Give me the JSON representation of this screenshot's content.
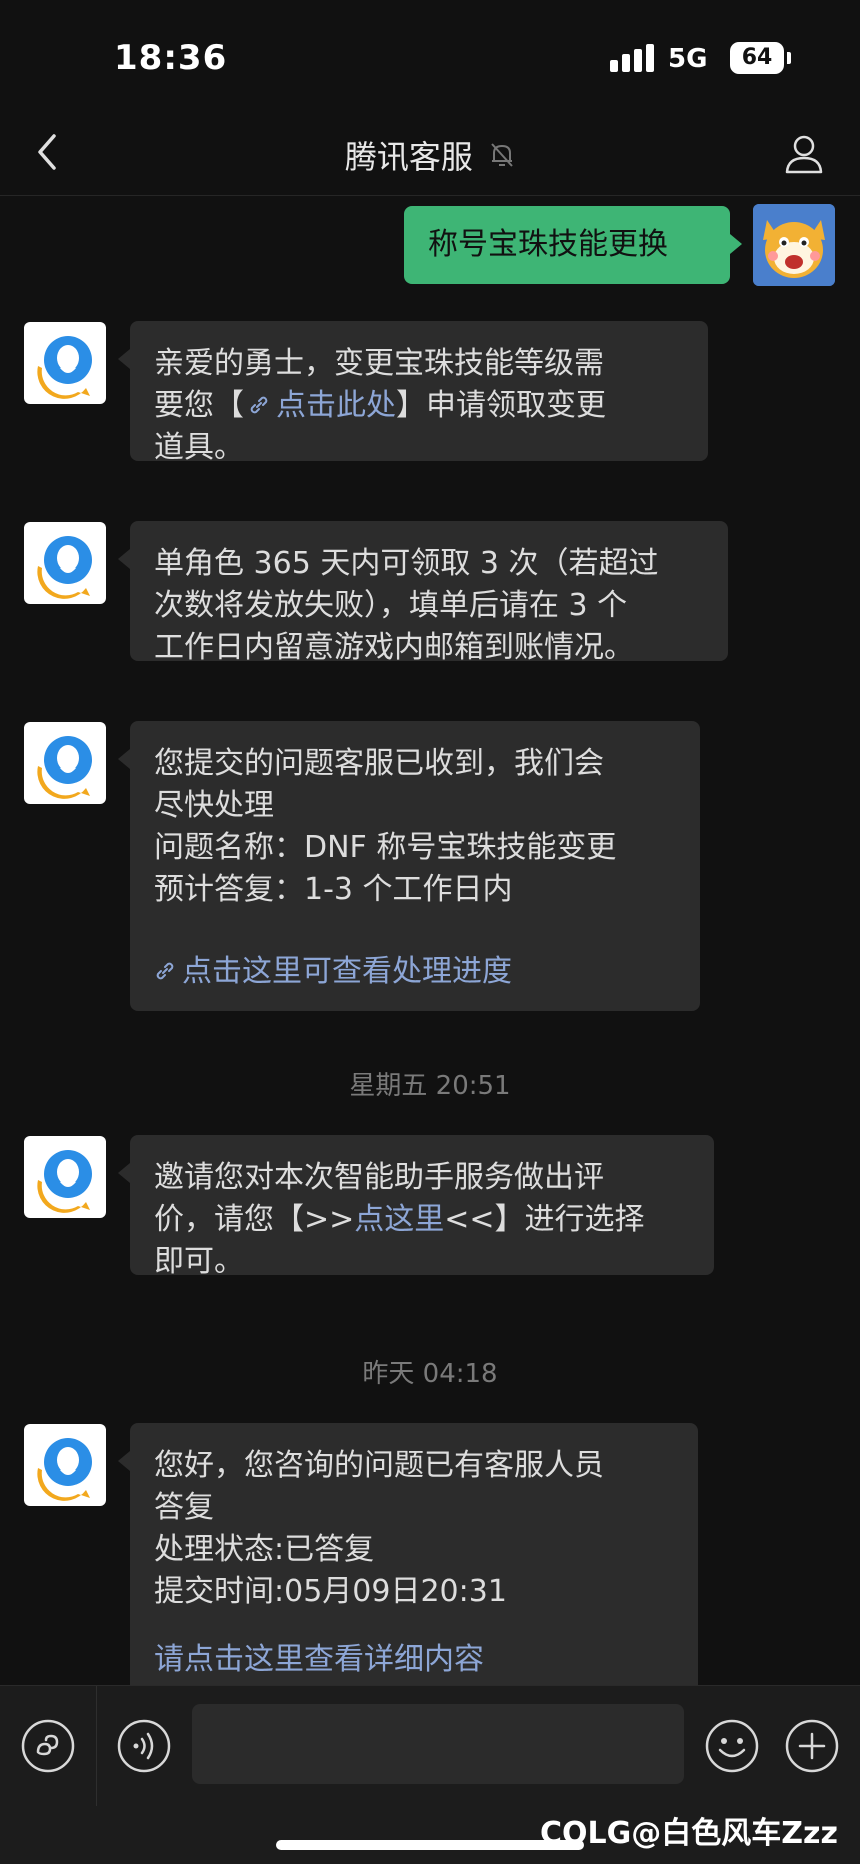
{
  "status_bar": {
    "time": "18:36",
    "network": "5G",
    "battery": "64"
  },
  "nav": {
    "title": "腾讯客服"
  },
  "messages": {
    "user_request": "称号宝珠技能更换",
    "m1": {
      "line1": "亲爱的勇士，变更宝珠技能等级需",
      "line2_pre": "要您【",
      "line2_link": "点击此处",
      "line2_post": "】申请领取变更",
      "line3": "道具。"
    },
    "m2": {
      "line1": "单角色 365 天内可领取 3 次（若超过",
      "line2": "次数将发放失败），填单后请在 3 个",
      "line3": "工作日内留意游戏内邮箱到账情况。"
    },
    "m3": {
      "line1": "您提交的问题客服已收到，我们会",
      "line2": "尽快处理",
      "line3": "问题名称：DNF 称号宝珠技能变更",
      "line4": "预计答复：1-3 个工作日内",
      "link": "点击这里可查看处理进度"
    },
    "ts1": "星期五 20:51",
    "m4": {
      "line1": "邀请您对本次智能助手服务做出评",
      "line2_pre": "价，请您【>>",
      "line2_link": "点这里",
      "line2_post": "<<】进行选择",
      "line3": "即可。"
    },
    "ts2": "昨天 04:18",
    "m5": {
      "line1": "您好，您咨询的问题已有客服人员",
      "line2": "答复",
      "line3": "处理状态:已答复",
      "line4": "提交时间:05月09日20:31",
      "link": "请点击这里查看详细内容"
    }
  },
  "watermark": "COLG@白色风车Zzz"
}
